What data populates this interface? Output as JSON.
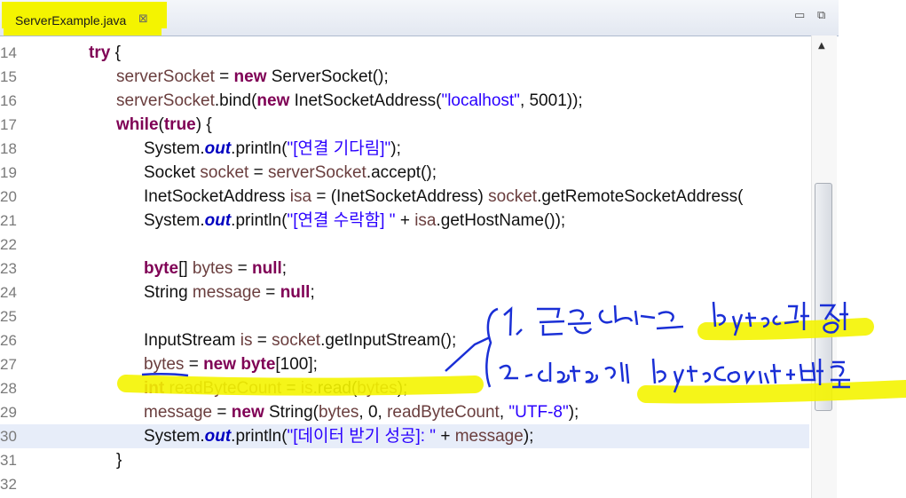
{
  "tab": {
    "title": "ServerExample.java",
    "close_glyph": "⊠"
  },
  "window": {
    "minimize_glyph": "▭",
    "restore_glyph": "⧉"
  },
  "lines": [
    {
      "n": "14",
      "c": "try {"
    },
    {
      "n": "15",
      "c": "serverSocket = new ServerSocket();"
    },
    {
      "n": "16",
      "c": "serverSocket.bind(new InetSocketAddress(\"localhost\", 5001));"
    },
    {
      "n": "17",
      "c": "while(true) {"
    },
    {
      "n": "18",
      "c": "System.out.println(\"[연결 기다림]\");"
    },
    {
      "n": "19",
      "c": "Socket socket = serverSocket.accept();"
    },
    {
      "n": "20",
      "c": "InetSocketAddress isa = (InetSocketAddress) socket.getRemoteSocketAddress("
    },
    {
      "n": "21",
      "c": "System.out.println(\"[연결 수락함] \" + isa.getHostName());"
    },
    {
      "n": "22",
      "c": ""
    },
    {
      "n": "23",
      "c": "byte[] bytes = null;"
    },
    {
      "n": "24",
      "c": "String message = null;"
    },
    {
      "n": "25",
      "c": ""
    },
    {
      "n": "26",
      "c": "InputStream is = socket.getInputStream();"
    },
    {
      "n": "27",
      "c": "bytes = new byte[100];"
    },
    {
      "n": "28",
      "c": "int readByteCount = is.read(bytes);"
    },
    {
      "n": "29",
      "c": "message = new String(bytes, 0, readByteCount, \"UTF-8\");"
    },
    {
      "n": "30",
      "c": "System.out.println(\"[데이터 받기 성공]: \" + message);"
    },
    {
      "n": "31",
      "c": "}"
    },
    {
      "n": "32",
      "c": ""
    }
  ],
  "annotations": {
    "note1": "1. 읽은 data는 bytes에 저장",
    "note2": "2. data의 byteCount 반환",
    "ink_color": "#1a2fd6",
    "highlight_color": "#f4f400"
  }
}
